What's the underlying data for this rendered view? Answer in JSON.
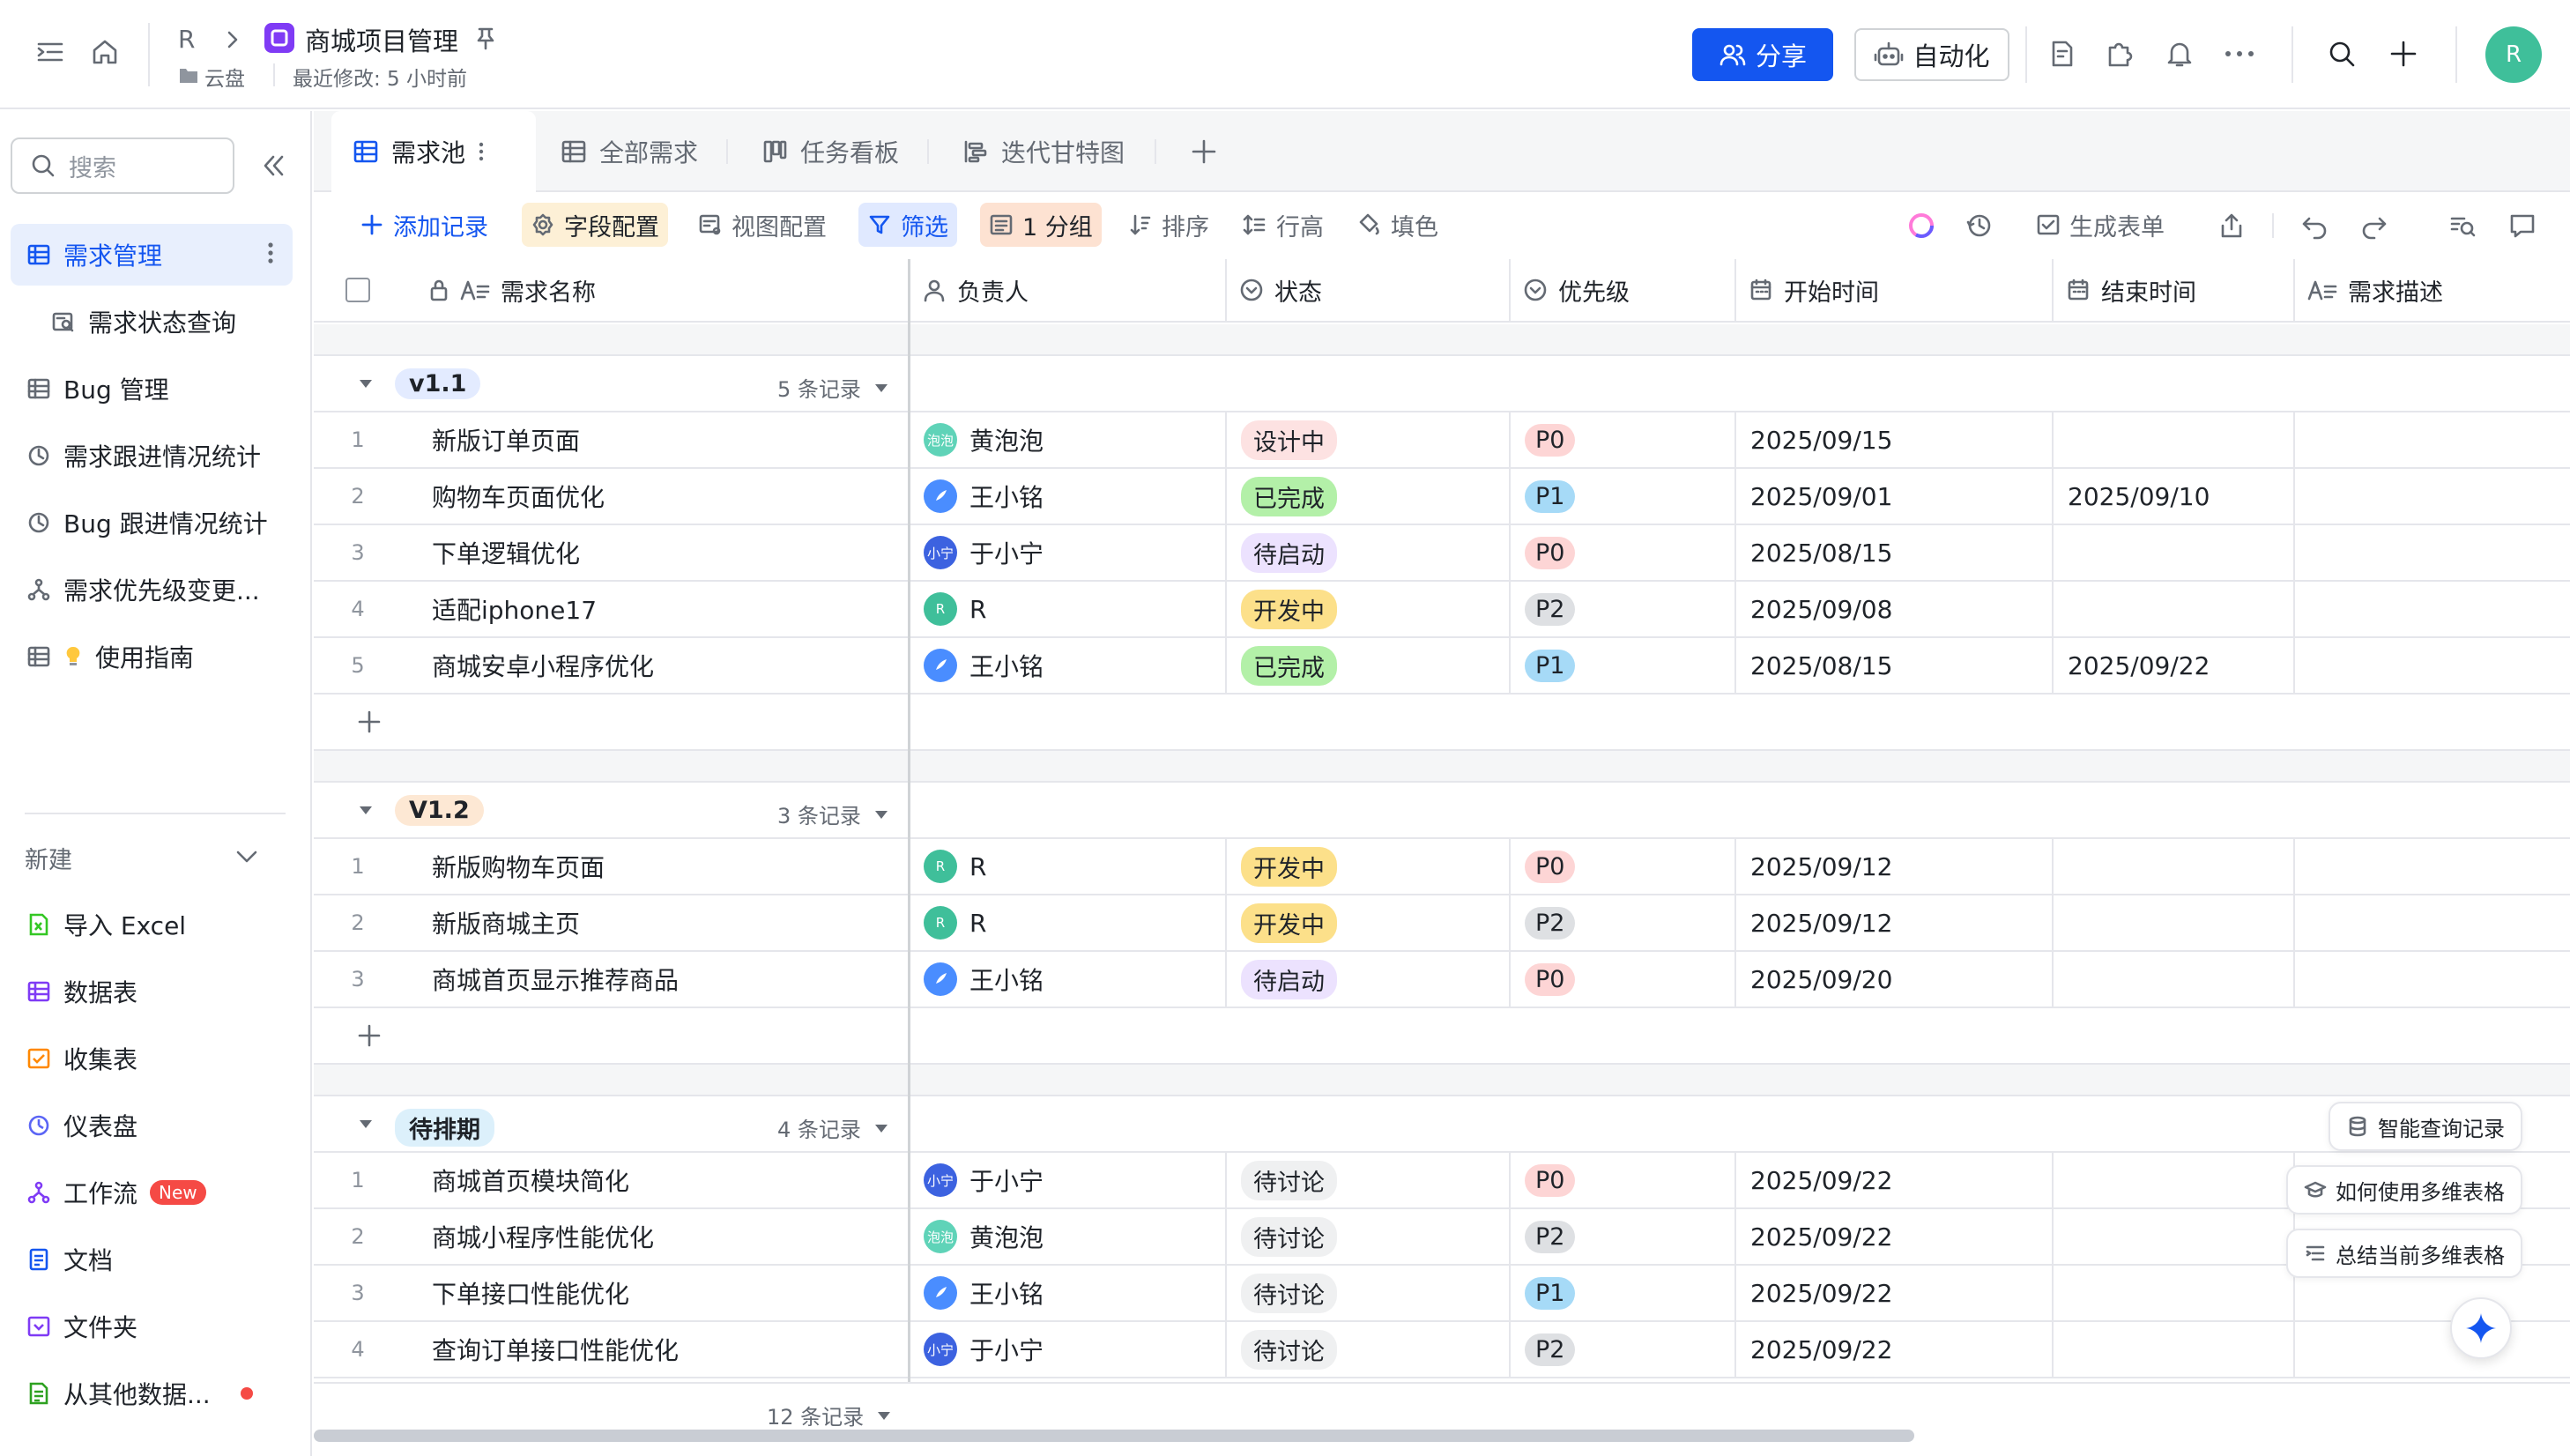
{
  "header": {
    "breadcrumb_root": "R",
    "title": "商城项目管理",
    "location": "云盘",
    "last_modified": "最近修改: 5 小时前",
    "share_label": "分享",
    "automation_label": "自动化",
    "user_initial": "R"
  },
  "sidebar": {
    "search_placeholder": "搜索",
    "items": [
      {
        "label": "需求管理"
      },
      {
        "label": "需求状态查询"
      },
      {
        "label": "Bug 管理"
      },
      {
        "label": "需求跟进情况统计"
      },
      {
        "label": "Bug 跟进情况统计"
      },
      {
        "label": "需求优先级变更..."
      },
      {
        "label": "使用指南"
      }
    ],
    "new_label": "新建",
    "new_items": [
      {
        "label": "导入 Excel"
      },
      {
        "label": "数据表"
      },
      {
        "label": "收集表"
      },
      {
        "label": "仪表盘"
      },
      {
        "label": "工作流",
        "badge": "New"
      },
      {
        "label": "文档"
      },
      {
        "label": "文件夹"
      },
      {
        "label": "从其他数据..."
      }
    ]
  },
  "tabs": [
    {
      "label": "需求池"
    },
    {
      "label": "全部需求"
    },
    {
      "label": "任务看板"
    },
    {
      "label": "迭代甘特图"
    }
  ],
  "toolbar": {
    "add_record": "添加记录",
    "field_config": "字段配置",
    "view_config": "视图配置",
    "filter": "筛选",
    "group": "1 分组",
    "sort": "排序",
    "row_height": "行高",
    "fill_color": "填色",
    "generate_form": "生成表单"
  },
  "columns": [
    {
      "label": "需求名称"
    },
    {
      "label": "负责人"
    },
    {
      "label": "状态"
    },
    {
      "label": "优先级"
    },
    {
      "label": "开始时间"
    },
    {
      "label": "结束时间"
    },
    {
      "label": "需求描述"
    }
  ],
  "groups": [
    {
      "name": "v1.1",
      "count": "5 条记录",
      "rows": [
        {
          "num": "1",
          "name": "新版订单页面",
          "owner": "黄泡泡",
          "avatar": "泡泡",
          "status": "设计中",
          "priority": "P0",
          "start": "2025/09/15",
          "end": ""
        },
        {
          "num": "2",
          "name": "购物车页面优化",
          "owner": "王小铭",
          "avatar": "",
          "status": "已完成",
          "priority": "P1",
          "start": "2025/09/01",
          "end": "2025/09/10"
        },
        {
          "num": "3",
          "name": "下单逻辑优化",
          "owner": "于小宁",
          "avatar": "小宁",
          "status": "待启动",
          "priority": "P0",
          "start": "2025/08/15",
          "end": ""
        },
        {
          "num": "4",
          "name": "适配iphone17",
          "owner": "R",
          "avatar": "R",
          "status": "开发中",
          "priority": "P2",
          "start": "2025/09/08",
          "end": ""
        },
        {
          "num": "5",
          "name": "商城安卓小程序优化",
          "owner": "王小铭",
          "avatar": "",
          "status": "已完成",
          "priority": "P1",
          "start": "2025/08/15",
          "end": "2025/09/22"
        }
      ]
    },
    {
      "name": "V1.2",
      "count": "3 条记录",
      "rows": [
        {
          "num": "1",
          "name": "新版购物车页面",
          "owner": "R",
          "avatar": "R",
          "status": "开发中",
          "priority": "P0",
          "start": "2025/09/12",
          "end": ""
        },
        {
          "num": "2",
          "name": "新版商城主页",
          "owner": "R",
          "avatar": "R",
          "status": "开发中",
          "priority": "P2",
          "start": "2025/09/12",
          "end": ""
        },
        {
          "num": "3",
          "name": "商城首页显示推荐商品",
          "owner": "王小铭",
          "avatar": "",
          "status": "待启动",
          "priority": "P0",
          "start": "2025/09/20",
          "end": ""
        }
      ]
    },
    {
      "name": "待排期",
      "count": "4 条记录",
      "rows": [
        {
          "num": "1",
          "name": "商城首页模块简化",
          "owner": "于小宁",
          "avatar": "小宁",
          "status": "待讨论",
          "priority": "P0",
          "start": "2025/09/22",
          "end": ""
        },
        {
          "num": "2",
          "name": "商城小程序性能优化",
          "owner": "黄泡泡",
          "avatar": "泡泡",
          "status": "待讨论",
          "priority": "P2",
          "start": "2025/09/22",
          "end": ""
        },
        {
          "num": "3",
          "name": "下单接口性能优化",
          "owner": "王小铭",
          "avatar": "",
          "status": "待讨论",
          "priority": "P1",
          "start": "2025/09/22",
          "end": ""
        },
        {
          "num": "4",
          "name": "查询订单接口性能优化",
          "owner": "于小宁",
          "avatar": "小宁",
          "status": "待讨论",
          "priority": "P2",
          "start": "2025/09/22",
          "end": ""
        }
      ]
    }
  ],
  "footer_count": "12 条记录",
  "ai_actions": [
    {
      "label": "智能查询记录"
    },
    {
      "label": "如何使用多维表格"
    },
    {
      "label": "总结当前多维表格"
    }
  ],
  "colors": {
    "accent": "#1456f0",
    "status": {
      "设计中": "#fde2e2",
      "已完成": "#b3f0a8",
      "待启动": "#ece2fe",
      "开发中": "#fce08a",
      "待讨论": "#eff0f1"
    },
    "priority": {
      "P0": "#fdd5d5",
      "P1": "#a6daf7",
      "P2": "#dee0e3"
    }
  }
}
